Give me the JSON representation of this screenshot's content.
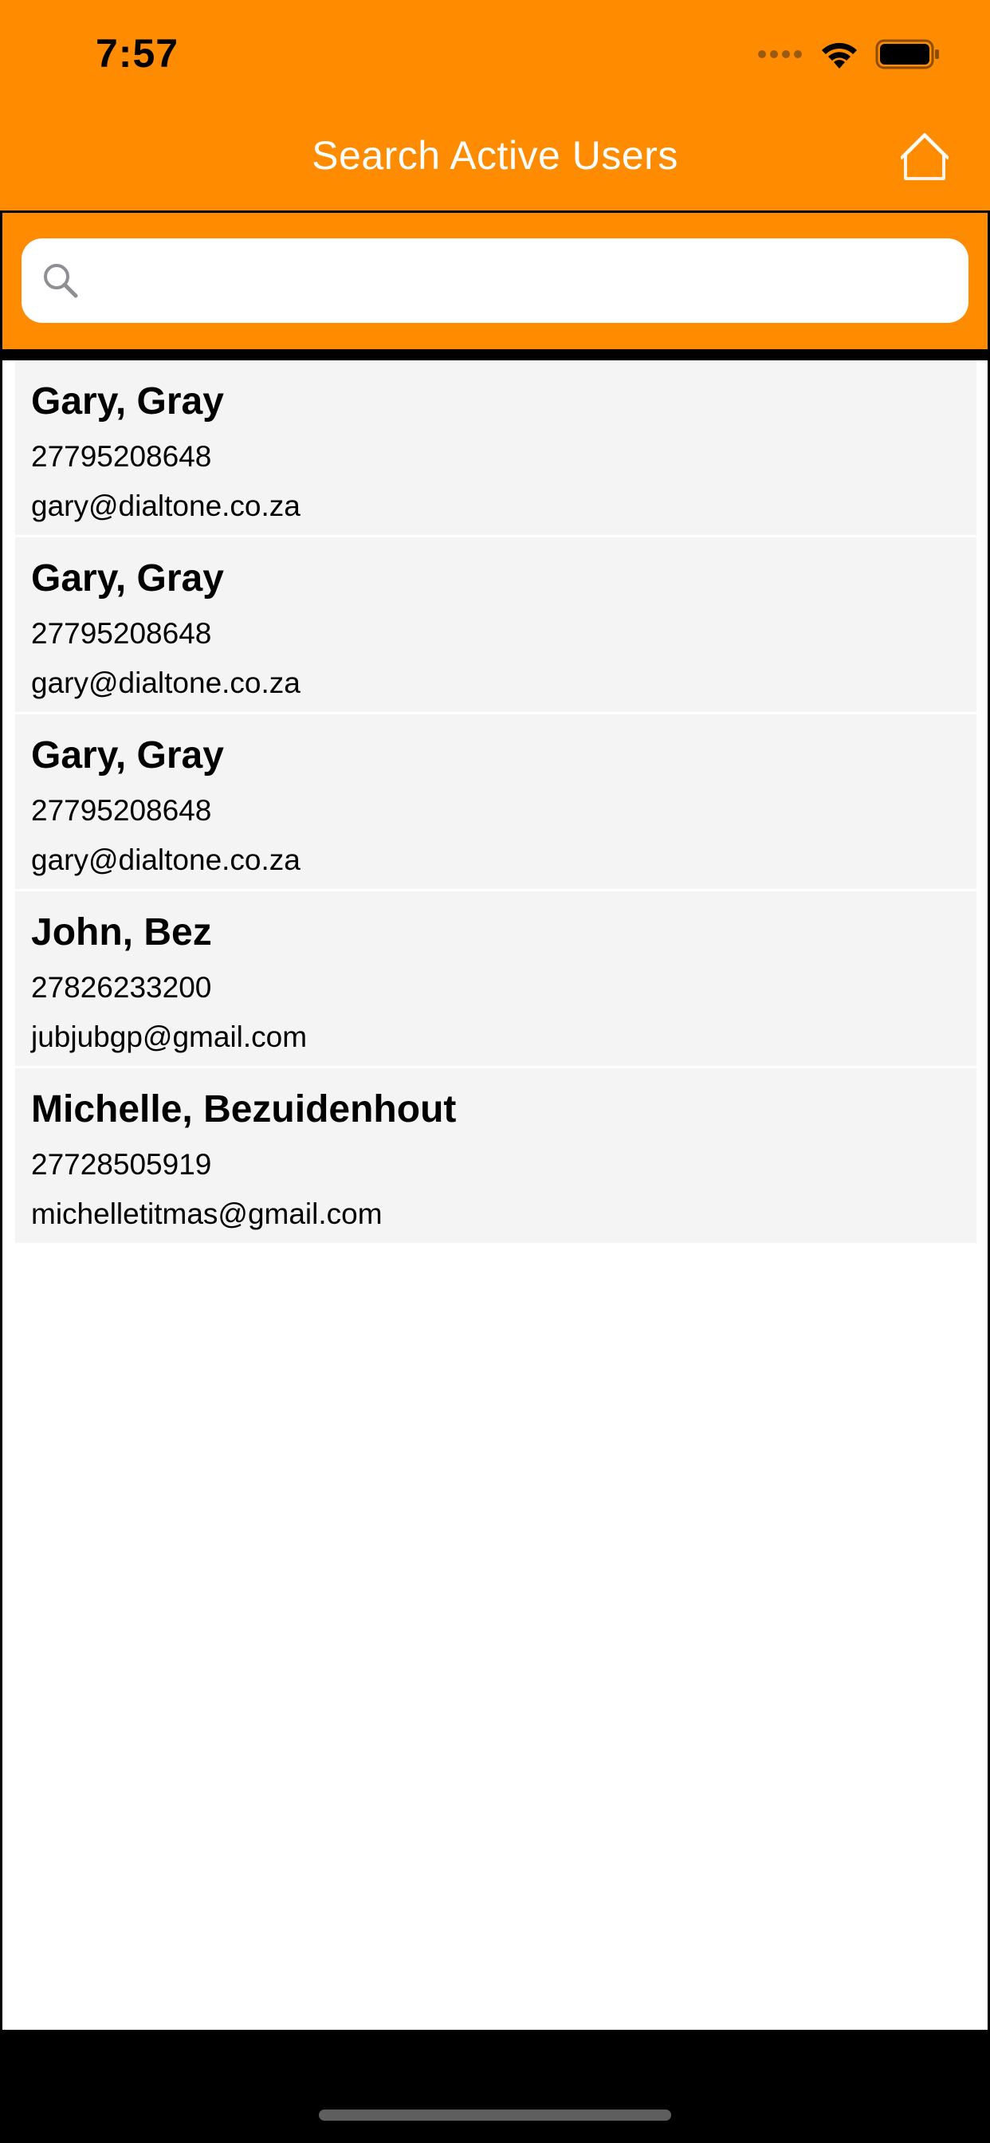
{
  "status_bar": {
    "time": "7:57",
    "icons": [
      "cellular-signal-icon",
      "wifi-icon",
      "battery-icon"
    ]
  },
  "nav_bar": {
    "title": "Search Active Users",
    "right_button_icon": "home-icon"
  },
  "search": {
    "value": "",
    "placeholder": "",
    "icon": "search-icon"
  },
  "users": [
    {
      "name": "Gary, Gray",
      "phone": "27795208648",
      "email": "gary@dialtone.co.za"
    },
    {
      "name": "Gary, Gray",
      "phone": "27795208648",
      "email": "gary@dialtone.co.za"
    },
    {
      "name": "Gary, Gray",
      "phone": "27795208648",
      "email": "gary@dialtone.co.za"
    },
    {
      "name": "John, Bez",
      "phone": "27826233200",
      "email": "jubjubgp@gmail.com"
    },
    {
      "name": "Michelle, Bezuidenhout",
      "phone": "27728505919",
      "email": "michelletitmas@gmail.com"
    }
  ],
  "colors": {
    "accent": "#FF8C00",
    "row_background": "#F4F4F4",
    "text": "#000000",
    "title_text": "#FFFFFF"
  }
}
